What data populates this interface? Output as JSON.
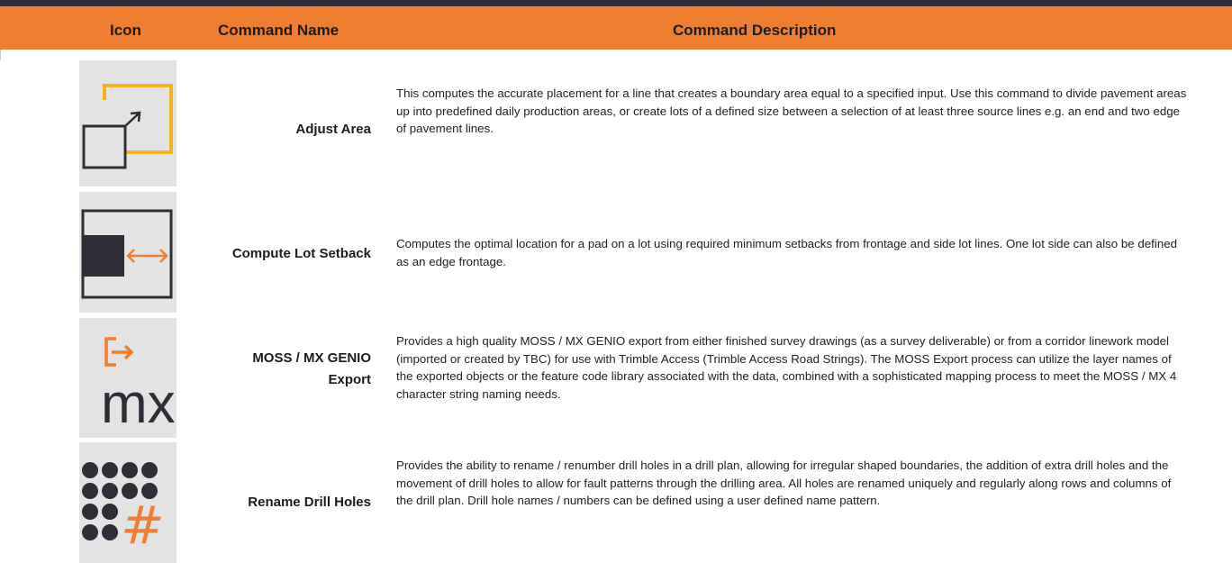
{
  "table": {
    "headers": {
      "icon": "Icon",
      "name": "Command Name",
      "description": "Command Description"
    },
    "rows": [
      {
        "icon": "adjust-area-icon",
        "name": "Adjust Area",
        "description": "This computes the accurate placement for a line that creates a boundary area equal to a specified input. Use this command to divide pavement areas up into predefined daily production areas, or create lots of a defined size between a selection of at least three source lines e.g. an end and two edge of pavement lines."
      },
      {
        "icon": "lot-setback-icon",
        "name": "Compute Lot Setback",
        "description": "Computes the optimal location for a pad on a lot using required minimum setbacks from frontage and side lot lines. One lot side can also be defined as an edge frontage."
      },
      {
        "icon": "mx-export-icon",
        "name_line1": "MOSS / MX GENIO",
        "name_line2": "Export",
        "icon_text": "mx",
        "description": "Provides a high quality MOSS / MX GENIO export from either finished survey drawings (as a survey deliverable) or from a corridor linework model (imported or created by TBC) for use with Trimble Access (Trimble Access Road Strings). The MOSS Export process can utilize the layer names of the exported objects or the feature code library associated with the data, combined with a sophisticated mapping process to meet the MOSS / MX 4 character string naming needs."
      },
      {
        "icon": "drill-holes-icon",
        "name": "Rename Drill Holes",
        "icon_text": "#",
        "description": "Provides the ability to rename / renumber drill holes in a drill plan, allowing for irregular shaped boundaries, the addition of extra drill holes and the movement of drill holes to allow for fault patterns through the drilling area. All holes are renamed uniquely and regularly along rows and columns of the drill plan. Drill hole names / numbers can be defined using a user defined name pattern."
      }
    ]
  },
  "colors": {
    "header": "#ef7e30",
    "topbar": "#2e2d33",
    "icon_bg": "#e3e3e3",
    "icon_dark": "#2f2e36",
    "icon_orange": "#ef7e30",
    "icon_yellow": "#f2b21b"
  }
}
